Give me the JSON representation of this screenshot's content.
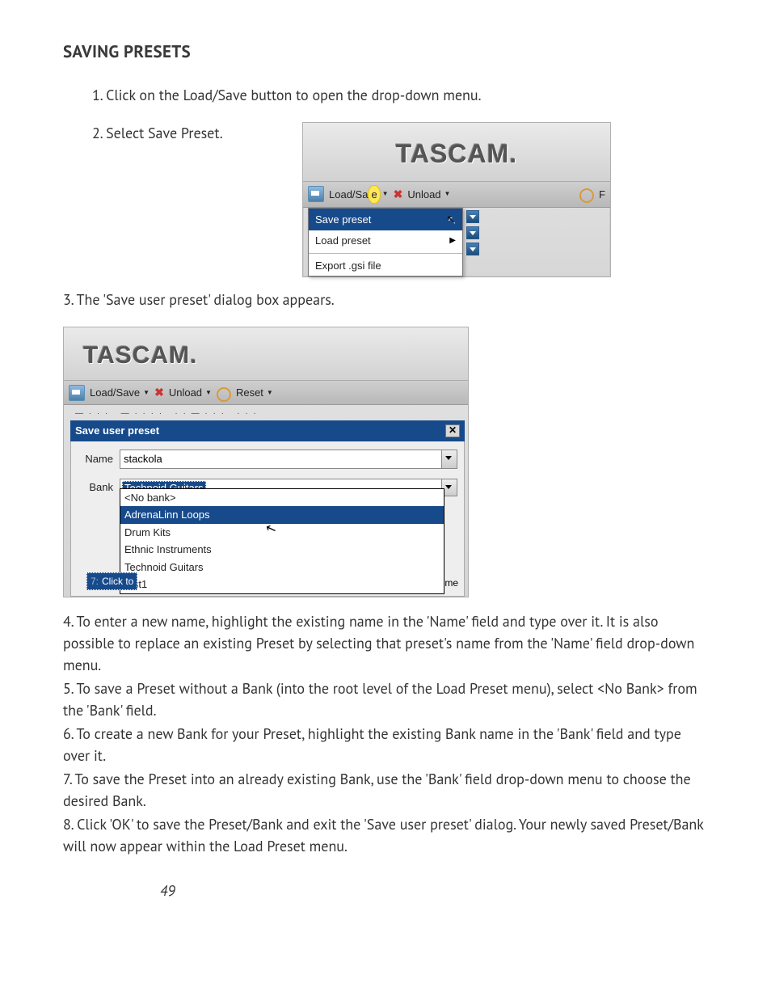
{
  "heading": "SAVING PRESETS",
  "step1": "1. Click on the Load/Save button to open the drop-down menu.",
  "step2": "2. Select Save Preset.",
  "step3": "3. The 'Save user preset' dialog box appears.",
  "screenshot1": {
    "logo": "TASCAM.",
    "toolbar": {
      "loadsave_pre": "Load/Sa",
      "loadsave_hl": "e",
      "unload": "Unload",
      "reset_frag": "F"
    },
    "menu": {
      "save_preset": "Save preset",
      "load_preset": "Load preset",
      "export_gsi": "Export .gsi file"
    }
  },
  "screenshot2": {
    "logo": "TASCAM.",
    "toolbar": {
      "loadsave": "Load/Save",
      "unload": "Unload",
      "reset": "Reset"
    },
    "dialog": {
      "title": "Save user preset",
      "name_label": "Name",
      "name_value": "stackola",
      "bank_label": "Bank",
      "bank_value": "Technoid Guitars",
      "options": {
        "nobank": "<No bank>",
        "adrenalinn": "AdrenaLinn Loops",
        "drumkits": "Drum Kits",
        "ethnic": "Ethnic Instruments",
        "technoid": "Technoid Guitars",
        "test1": "test1"
      },
      "clickto_prefix": "7:",
      "clickto": "Click to",
      "me_frag": "me"
    }
  },
  "para4": "4. To enter a new name, highlight the existing name in the 'Name' field and type over it. It is also possible to replace an existing Preset by selecting that preset's name from the 'Name' field drop-down menu.",
  "para5": "5. To save a Preset without a Bank (into the root level of the Load Preset menu), select <No Bank> from the 'Bank' field.",
  "para6": "6. To create a new Bank for your Preset, highlight the existing Bank name in the 'Bank' field and type over it.",
  "para7": "7. To save the Preset into an already existing Bank, use the 'Bank' field drop-down menu to choose the desired Bank.",
  "para8": "8. Click 'OK' to save the Preset/Bank and exit the 'Save user preset' dialog. Your newly saved Preset/Bank will now appear within the Load Preset menu.",
  "page_number": "49"
}
